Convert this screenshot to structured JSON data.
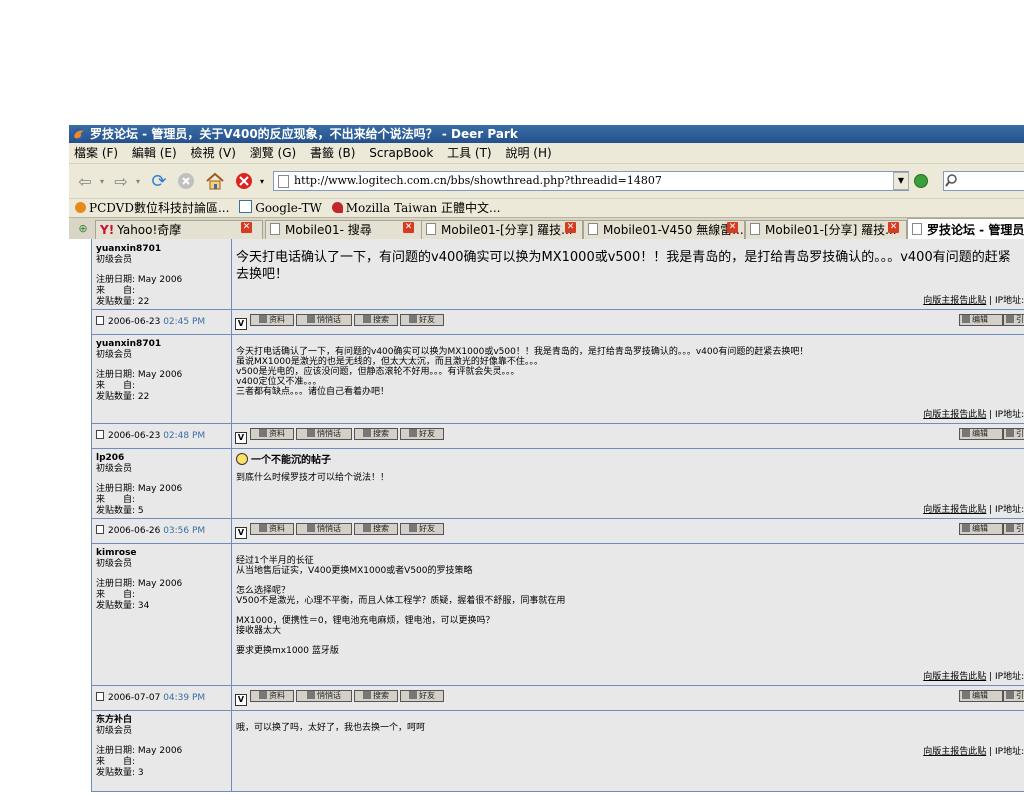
{
  "window": {
    "title": "罗技论坛 - 管理员，关于V400的反应现象，不出来给个说法吗？ - Deer Park"
  },
  "menu": [
    "檔案 (F)",
    "編輯 (E)",
    "檢視 (V)",
    "瀏覽 (G)",
    "書籤 (B)",
    "ScrapBook",
    "工具 (T)",
    "說明 (H)"
  ],
  "nav": {
    "url": "http://www.logitech.com.cn/bbs/showthread.php?threadid=14807"
  },
  "bookmarks": [
    "PCDVD數位科技討論區...",
    "Google-TW",
    "Mozilla Taiwan 正體中文..."
  ],
  "tabs": [
    "Yahoo!奇摩",
    "Mobile01- 搜尋",
    "Mobile01-[分享] 羅技...",
    "Mobile01-V450 無線雷...",
    "Mobile01-[分享] 羅技...",
    "罗技论坛 - 管理员"
  ],
  "labels": {
    "register": "注册日期: May 2006",
    "from": "来　　自:",
    "postcount_prefix": "发贴数量: ",
    "report": "向版主报告此贴",
    "ip": "IP地址: 已",
    "btn_profile": "资料",
    "btn_pm": "悄悄话",
    "btn_search": "搜索",
    "btn_friend": "好友",
    "btn_edit": "编辑",
    "btn_quote": "引",
    "v_icon": "V"
  },
  "posts": [
    {
      "author": "yuanxin8701",
      "rank": "初级会员",
      "count": "22",
      "body_big": "今天打电话确认了一下，有问题的v400确实可以换为MX1000或v500！！我是青岛的，是打给青岛罗技确认的。。。v400有问题的赶紧去换吧！",
      "date": "2006-06-23",
      "time": "02:45 PM"
    },
    {
      "author": "yuanxin8701",
      "rank": "初级会员",
      "count": "22",
      "lines": [
        "今天打电话确认了一下，有问题的v400确实可以换为MX1000或v500！！我是青岛的，是打给青岛罗技确认的。。。v400有问题的赶紧去换吧！",
        "虽说MX1000是激光的也是无线的，但太大太沉，而且激光的好像靠不住。。。",
        "v500是光电的，应该没问题，但静态滚轮不好用。。。有评就会失灵。。。",
        "v400定位又不准。。。",
        "三者都有缺点。。。诸位自己看着办吧！"
      ],
      "date": "2006-06-23",
      "time": "02:48 PM"
    },
    {
      "author": "lp206",
      "rank": "初级会员",
      "count": "5",
      "title": "一个不能沉的帖子",
      "lines": [
        "到底什么时候罗技才可以给个说法！！"
      ],
      "date": "2006-06-26",
      "time": "03:56 PM"
    },
    {
      "author": "kimrose",
      "rank": "初级会员",
      "count": "34",
      "lines": [
        "经过1个半月的长征",
        "从当地售后证实，V400更换MX1000或者V500的罗技策略",
        "",
        "怎么选择呢？",
        "V500不是激光，心理不平衡，而且人体工程学？质疑，握着很不舒服，同事就在用",
        "",
        "MX1000，便携性＝0，锂电池充电麻烦，锂电池，可以更换吗？",
        "接收器太大",
        "",
        "要求更换mx1000 蓝牙版"
      ],
      "date": "2006-07-07",
      "time": "04:39 PM"
    },
    {
      "author": "东方补白",
      "rank": "初级会员",
      "count": "3",
      "lines": [
        "哦，可以换了吗，太好了，我也去换一个，呵呵"
      ]
    }
  ]
}
